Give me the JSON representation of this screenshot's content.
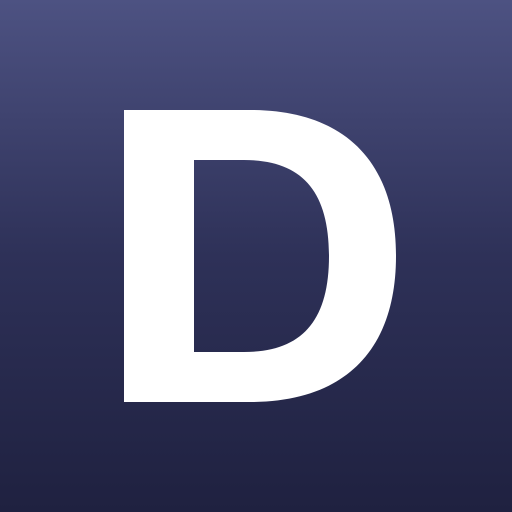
{
  "icon": {
    "letter": "D",
    "colors": {
      "gradient_top": "#4d5282",
      "gradient_mid": "#2e3158",
      "gradient_bottom": "#1f2140",
      "glyph": "#ffffff"
    }
  }
}
